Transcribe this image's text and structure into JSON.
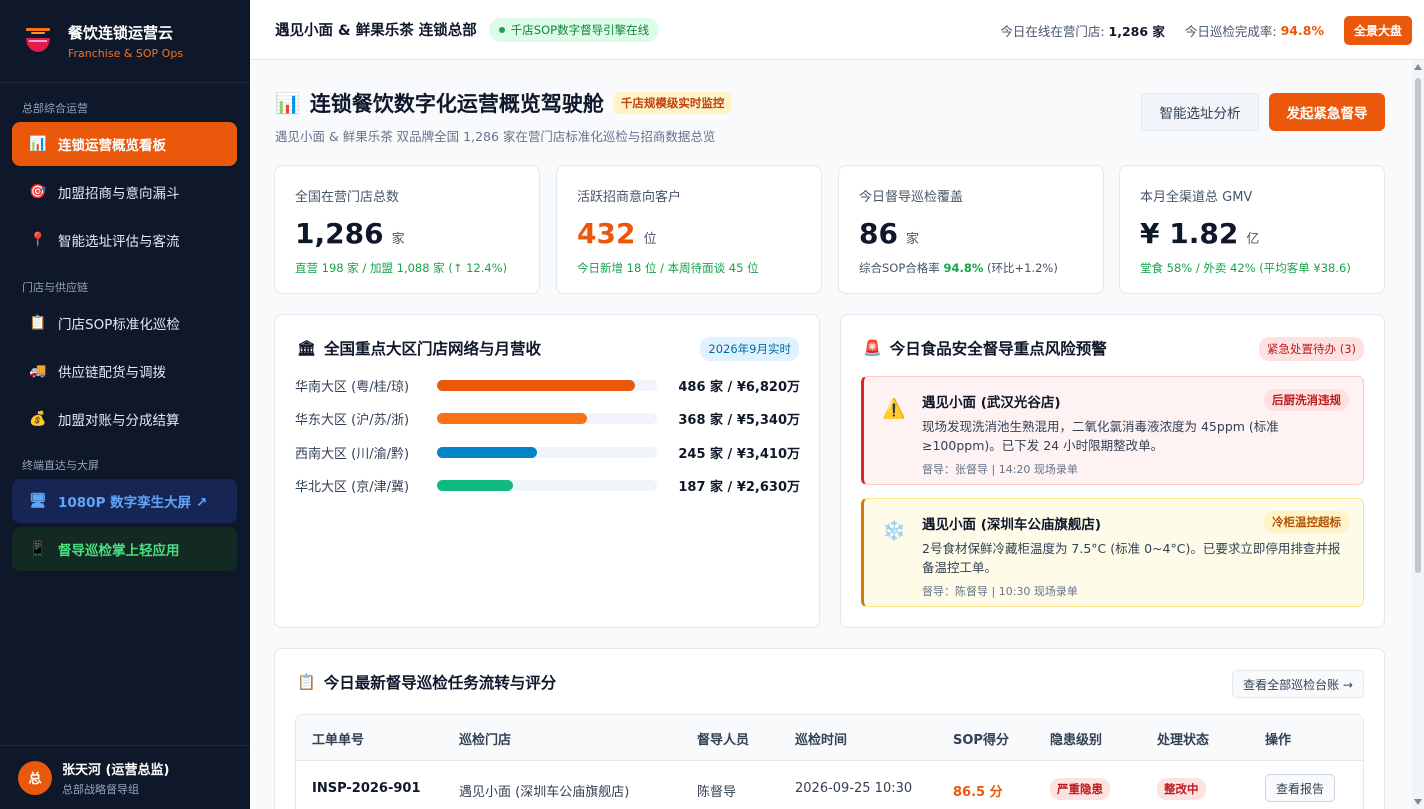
{
  "brand": {
    "title": "餐饮连锁运营云",
    "subtitle": "Franchise & SOP Ops"
  },
  "sidebar": {
    "sections": [
      "总部综合运营",
      "门店与供应链",
      "终端直达与大屏"
    ],
    "items": [
      {
        "label": "连锁运营概览看板",
        "icon": "📊"
      },
      {
        "label": "加盟招商与意向漏斗",
        "icon": "🎯"
      },
      {
        "label": "智能选址评估与客流",
        "icon": "📍"
      },
      {
        "label": "门店SOP标准化巡检",
        "icon": "📋"
      },
      {
        "label": "供应链配货与调拨",
        "icon": "🚚"
      },
      {
        "label": "加盟对账与分成结算",
        "icon": "💰"
      },
      {
        "label": "1080P 数字孪生大屏 ↗",
        "icon": "🖥"
      },
      {
        "label": "督导巡检掌上轻应用",
        "icon": "📱"
      }
    ]
  },
  "user": {
    "avatar": "总",
    "name": "张天河 (运营总监)",
    "role": "总部战略督导组"
  },
  "topbar": {
    "title": "遇见小面 & 鲜果乐茶 连锁总部",
    "status": "千店SOP数字督导引擎在线",
    "online_label": "今日在线在营门店:",
    "online_value": "1,286 家",
    "rate_label": "今日巡检完成率:",
    "rate_value": "94.8%",
    "panorama_button": "全景大盘"
  },
  "page": {
    "icon": "📊",
    "title": "连锁餐饮数字化运营概览驾驶舱",
    "tag": "千店规模级实时监控",
    "subtitle": "遇见小面 & 鲜果乐茶 双品牌全国 1,286 家在营门店标准化巡检与招商数据总览",
    "site_button": "智能选址分析",
    "urgent_button": "发起紧急督导"
  },
  "kpis": [
    {
      "label": "全国在营门店总数",
      "value": "1,286",
      "unit": "家",
      "note": "直营 198 家 / 加盟 1,088 家 (↑ 12.4%)"
    },
    {
      "label": "活跃招商意向客户",
      "value": "432",
      "unit": "位",
      "note": "今日新增 18 位 / 本周待面谈 45 位"
    },
    {
      "label": "今日督导巡检覆盖",
      "value": "86",
      "unit": "家",
      "note_prefix": "综合SOP合格率 ",
      "note_highlight": "94.8%",
      "note_suffix": " (环比+1.2%)"
    },
    {
      "label": "本月全渠道总 GMV",
      "value": "¥ 1.82",
      "unit": "亿",
      "note": "堂食 58% / 外卖 42% (平均客单 ¥38.6)"
    }
  ],
  "regions": {
    "icon": "🏛",
    "title": "全国重点大区门店网络与月营收",
    "badge": "2026年9月实时",
    "rows": [
      {
        "name": "华南大区 (粤/桂/琼)",
        "stores": 486,
        "value": "486 家 / ¥6,820万",
        "color": "#ea580c"
      },
      {
        "name": "华东大区 (沪/苏/浙)",
        "stores": 368,
        "value": "368 家 / ¥5,340万",
        "color": "#f97316"
      },
      {
        "name": "西南大区 (川/渝/黔)",
        "stores": 245,
        "value": "245 家 / ¥3,410万",
        "color": "#0284c7"
      },
      {
        "name": "华北大区 (京/津/冀)",
        "stores": 187,
        "value": "187 家 / ¥2,630万",
        "color": "#10b981"
      }
    ],
    "max_stores": 540
  },
  "risk": {
    "icon": "🚨",
    "title": "今日食品安全督导重点风险预警",
    "badge": "紧急处置待办 (3)",
    "alerts": [
      {
        "icon": "⚠️",
        "store": "遇见小面 (武汉光谷店)",
        "tag": "后厨洗消违规",
        "desc": "现场发现洗消池生熟混用，二氧化氯消毒液浓度为 45ppm (标准 ≥100ppm)。已下发 24 小时限期整改单。",
        "meta": "督导：张督导 | 14:20 现场录单"
      },
      {
        "icon": "❄️",
        "store": "遇见小面 (深圳车公庙旗舰店)",
        "tag": "冷柜温控超标",
        "desc": "2号食材保鲜冷藏柜温度为 7.5°C (标准 0~4°C)。已要求立即停用排查并报备温控工单。",
        "meta": "督导：陈督导 | 10:30 现场录单"
      }
    ]
  },
  "inspections": {
    "icon": "📋",
    "title": "今日最新督导巡检任务流转与评分",
    "ledger_button": "查看全部巡检台账 →",
    "columns": [
      "工单单号",
      "巡检门店",
      "督导人员",
      "巡检时间",
      "SOP得分",
      "隐患级别",
      "处理状态",
      "操作"
    ],
    "rows": [
      {
        "id": "INSP-2026-901",
        "store": "遇见小面 (深圳车公庙旗舰店)",
        "inspector": "陈督导",
        "time": "2026-09-25 10:30",
        "score": "86.5 分",
        "level": "严重隐患",
        "status": "整改中",
        "action": "查看报告"
      }
    ]
  }
}
